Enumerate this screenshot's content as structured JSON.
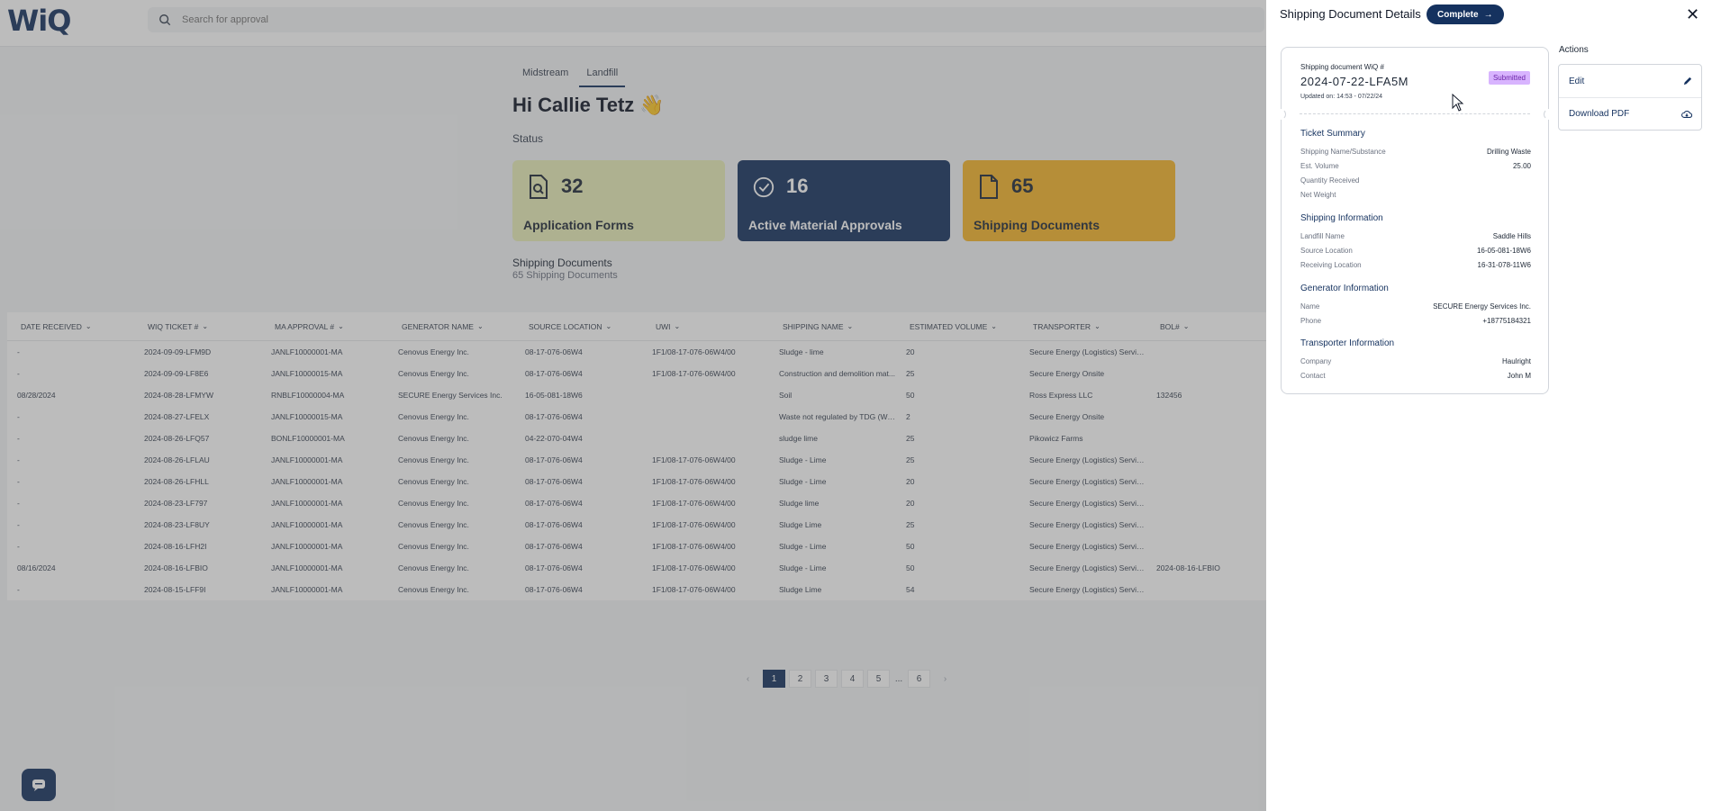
{
  "app": {
    "logo": "WiQ"
  },
  "search": {
    "placeholder": "Search for approval"
  },
  "tabs": [
    {
      "label": "Midstream",
      "active": false
    },
    {
      "label": "Landfill",
      "active": true
    }
  ],
  "greeting": "Hi Callie Tetz 👋",
  "status_label": "Status",
  "cards": [
    {
      "count": "32",
      "label": "Application Forms",
      "icon": "file-search-icon",
      "color": "#e8edb8"
    },
    {
      "count": "16",
      "label": "Active Material Approvals",
      "icon": "check-circle-icon",
      "color": "#15325f"
    },
    {
      "count": "65",
      "label": "Shipping Documents",
      "icon": "file-icon",
      "color": "#f6b52a"
    }
  ],
  "list": {
    "title": "Shipping Documents",
    "subtitle": "65 Shipping Documents"
  },
  "table": {
    "columns": [
      "DATE RECEIVED",
      "WIQ TICKET #",
      "MA APPROVAL #",
      "GENERATOR NAME",
      "SOURCE LOCATION",
      "UWI",
      "SHIPPING NAME",
      "ESTIMATED VOLUME",
      "TRANSPORTER",
      "BOL#"
    ],
    "rows": [
      [
        "-",
        "2024-09-09-LFM9D",
        "JANLF10000001-MA",
        "Cenovus Energy Inc.",
        "08-17-076-06W4",
        "1F1/08-17-076-06W4/00",
        "Sludge - lime",
        "20",
        "Secure Energy (Logistics) Servic...",
        ""
      ],
      [
        "-",
        "2024-09-09-LF8E6",
        "JANLF10000015-MA",
        "Cenovus Energy Inc.",
        "08-17-076-06W4",
        "1F1/08-17-076-06W4/00",
        "Construction and demolition mat...",
        "25",
        "Secure Energy Onsite",
        ""
      ],
      [
        "08/28/2024",
        "2024-08-28-LFMYW",
        "RNBLF10000004-MA",
        "SECURE Energy Services Inc.",
        "16-05-081-18W6",
        "",
        "Soil",
        "50",
        "Ross Express LLC",
        "132456"
      ],
      [
        "-",
        "2024-08-27-LFELX",
        "JANLF10000015-MA",
        "Cenovus Energy Inc.",
        "08-17-076-06W4",
        "",
        "Waste not regulated by TDG (Wo...",
        "2",
        "Secure Energy Onsite",
        ""
      ],
      [
        "-",
        "2024-08-26-LFQ57",
        "BONLF10000001-MA",
        "Cenovus Energy Inc.",
        "04-22-070-04W4",
        "",
        "sludge lime",
        "25",
        "Pikowicz Farms",
        ""
      ],
      [
        "-",
        "2024-08-26-LFLAU",
        "JANLF10000001-MA",
        "Cenovus Energy Inc.",
        "08-17-076-06W4",
        "1F1/08-17-076-06W4/00",
        "Sludge - Lime",
        "25",
        "Secure Energy (Logistics) Servic...",
        ""
      ],
      [
        "-",
        "2024-08-26-LFHLL",
        "JANLF10000001-MA",
        "Cenovus Energy Inc.",
        "08-17-076-06W4",
        "1F1/08-17-076-06W4/00",
        "Sludge - Lime",
        "20",
        "Secure Energy (Logistics) Servic...",
        ""
      ],
      [
        "-",
        "2024-08-23-LF797",
        "JANLF10000001-MA",
        "Cenovus Energy Inc.",
        "08-17-076-06W4",
        "1F1/08-17-076-06W4/00",
        "Sludge lime",
        "20",
        "Secure Energy (Logistics) Servic...",
        ""
      ],
      [
        "-",
        "2024-08-23-LF8UY",
        "JANLF10000001-MA",
        "Cenovus Energy Inc.",
        "08-17-076-06W4",
        "1F1/08-17-076-06W4/00",
        "Sludge Lime",
        "25",
        "Secure Energy (Logistics) Servic...",
        ""
      ],
      [
        "-",
        "2024-08-16-LFH2I",
        "JANLF10000001-MA",
        "Cenovus Energy Inc.",
        "08-17-076-06W4",
        "1F1/08-17-076-06W4/00",
        "Sludge - Lime",
        "50",
        "Secure Energy (Logistics) Servic...",
        ""
      ],
      [
        "08/16/2024",
        "2024-08-16-LFBIO",
        "JANLF10000001-MA",
        "Cenovus Energy Inc.",
        "08-17-076-06W4",
        "1F1/08-17-076-06W4/00",
        "Sludge - Lime",
        "50",
        "Secure Energy (Logistics) Servic...",
        "2024-08-16-LFBIO"
      ],
      [
        "-",
        "2024-08-15-LFF9I",
        "JANLF10000001-MA",
        "Cenovus Energy Inc.",
        "08-17-076-06W4",
        "1F1/08-17-076-06W4/00",
        "Sludge Lime",
        "54",
        "Secure Energy (Logistics) Servic...",
        ""
      ]
    ]
  },
  "pagination": {
    "prev": "‹",
    "next": "›",
    "pages": [
      "1",
      "2",
      "3",
      "4",
      "5"
    ],
    "ellipsis": "...",
    "last": "6",
    "current": "1"
  },
  "panel": {
    "title": "Shipping Document Details",
    "complete_label": "Complete",
    "complete_arrow": "→",
    "close": "✕",
    "doc_label": "Shipping document WiQ #",
    "doc_number": "2024-07-22-LFA5M",
    "updated": "Updated on: 14:53 - 07/22/24",
    "status_badge": "Submitted",
    "ticket_summary": {
      "title": "Ticket Summary",
      "rows": [
        {
          "k": "Shipping Name/Substance",
          "v": "Drilling Waste"
        },
        {
          "k": "Est. Volume",
          "v": "25.00"
        },
        {
          "k": "Quantity Received",
          "v": ""
        },
        {
          "k": "Net Weight",
          "v": ""
        }
      ]
    },
    "shipping_info": {
      "title": "Shipping Information",
      "rows": [
        {
          "k": "Landfill Name",
          "v": "Saddle Hills"
        },
        {
          "k": "Source Location",
          "v": "16-05-081-18W6"
        },
        {
          "k": "Receiving Location",
          "v": "16-31-078-11W6"
        }
      ]
    },
    "generator_info": {
      "title": "Generator Information",
      "rows": [
        {
          "k": "Name",
          "v": "SECURE Energy Services Inc."
        },
        {
          "k": "Phone",
          "v": "+18775184321"
        }
      ]
    },
    "transporter_info": {
      "title": "Transporter Information",
      "rows": [
        {
          "k": "Company",
          "v": "Haulright"
        },
        {
          "k": "Contact",
          "v": "John M"
        }
      ]
    },
    "actions_label": "Actions",
    "actions": [
      {
        "label": "Edit",
        "icon": "pencil-icon"
      },
      {
        "label": "Download PDF",
        "icon": "cloud-download-icon"
      }
    ]
  }
}
